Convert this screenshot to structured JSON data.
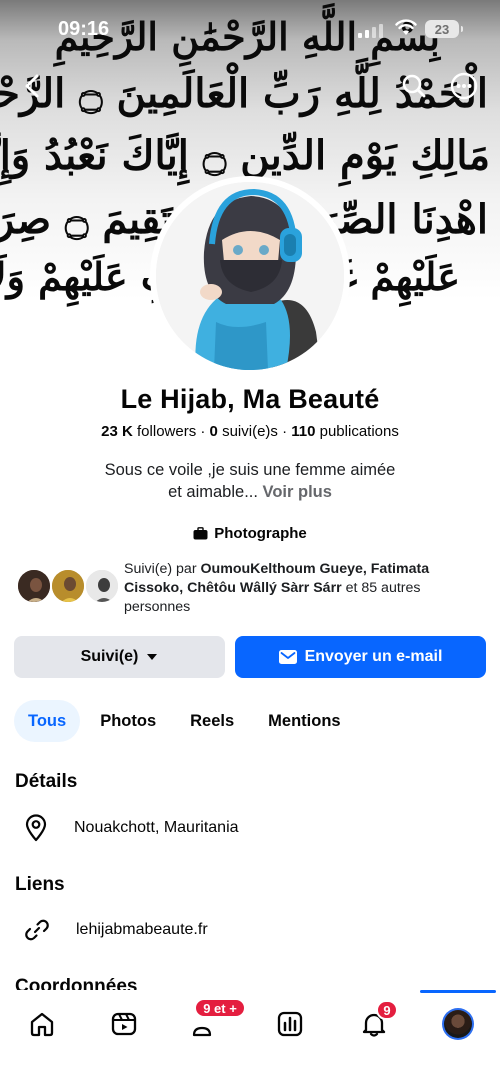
{
  "status_bar": {
    "time": "09:16",
    "battery": "23"
  },
  "cover": {
    "calligraphy": [
      "بِسْمِ اللَّهِ الرَّحْمَٰنِ الرَّحِيمِ",
      "الْحَمْدُ لِلَّهِ رَبِّ الْعَالَمِينَ ۝ الرَّحْمَٰنِ الرَّحِيمِ ۝",
      "مَالِكِ يَوْمِ الدِّينِ ۝ إِيَّاكَ نَعْبُدُ وَإِيَّاكَ نَسْتَعِينُ ۝",
      "اهْدِنَا الصِّرَاطَ الْمُسْتَقِيمَ ۝ صِرَاطَ الَّذِينَ أَنْعَمْتَ",
      "عَلَيْهِمْ غَيْرِ الْمَغْضُوبِ عَلَيْهِمْ وَلَا الضَّالِّينَ ۝"
    ]
  },
  "profile": {
    "name": "Le Hijab, Ma Beauté",
    "followers_count": "23 K",
    "followers_label": "followers",
    "following_count": "0",
    "following_label": "suivi(e)s",
    "posts_count": "110",
    "posts_label": "publications",
    "separator": "·",
    "bio_line1": "Sous ce voile ,je suis une femme aimée",
    "bio_line2": "et aimable...",
    "see_more": "Voir plus",
    "category": "Photographe"
  },
  "followed_by": {
    "prefix": "Suivi(e) par",
    "names": "OumouKelthoum Gueye, Fatimata Cissoko, Chêtôu Wâllý Sàrr Sárr",
    "suffix": "et 85 autres personnes"
  },
  "actions": {
    "follow_label": "Suivi(e)",
    "email_label": "Envoyer un e-mail"
  },
  "tabs": [
    {
      "label": "Tous",
      "active": true
    },
    {
      "label": "Photos",
      "active": false
    },
    {
      "label": "Reels",
      "active": false
    },
    {
      "label": "Mentions",
      "active": false
    }
  ],
  "details": {
    "title": "Détails",
    "location": "Nouakchott, Mauritania"
  },
  "links": {
    "title": "Liens",
    "website": "lehijabmabeaute.fr"
  },
  "contact": {
    "title": "Coordonnées"
  },
  "bottom_nav": {
    "items": [
      "home-icon",
      "video-icon",
      "friends-icon",
      "dashboard-icon",
      "notifications-icon",
      "profile-avatar"
    ],
    "friends_badge": "9 et +",
    "notifications_badge": "9"
  },
  "colors": {
    "accent": "#0866ff",
    "secondary_button": "#e4e6eb",
    "active_tab_bg": "#ebf5ff",
    "badge": "#e41e3f"
  }
}
